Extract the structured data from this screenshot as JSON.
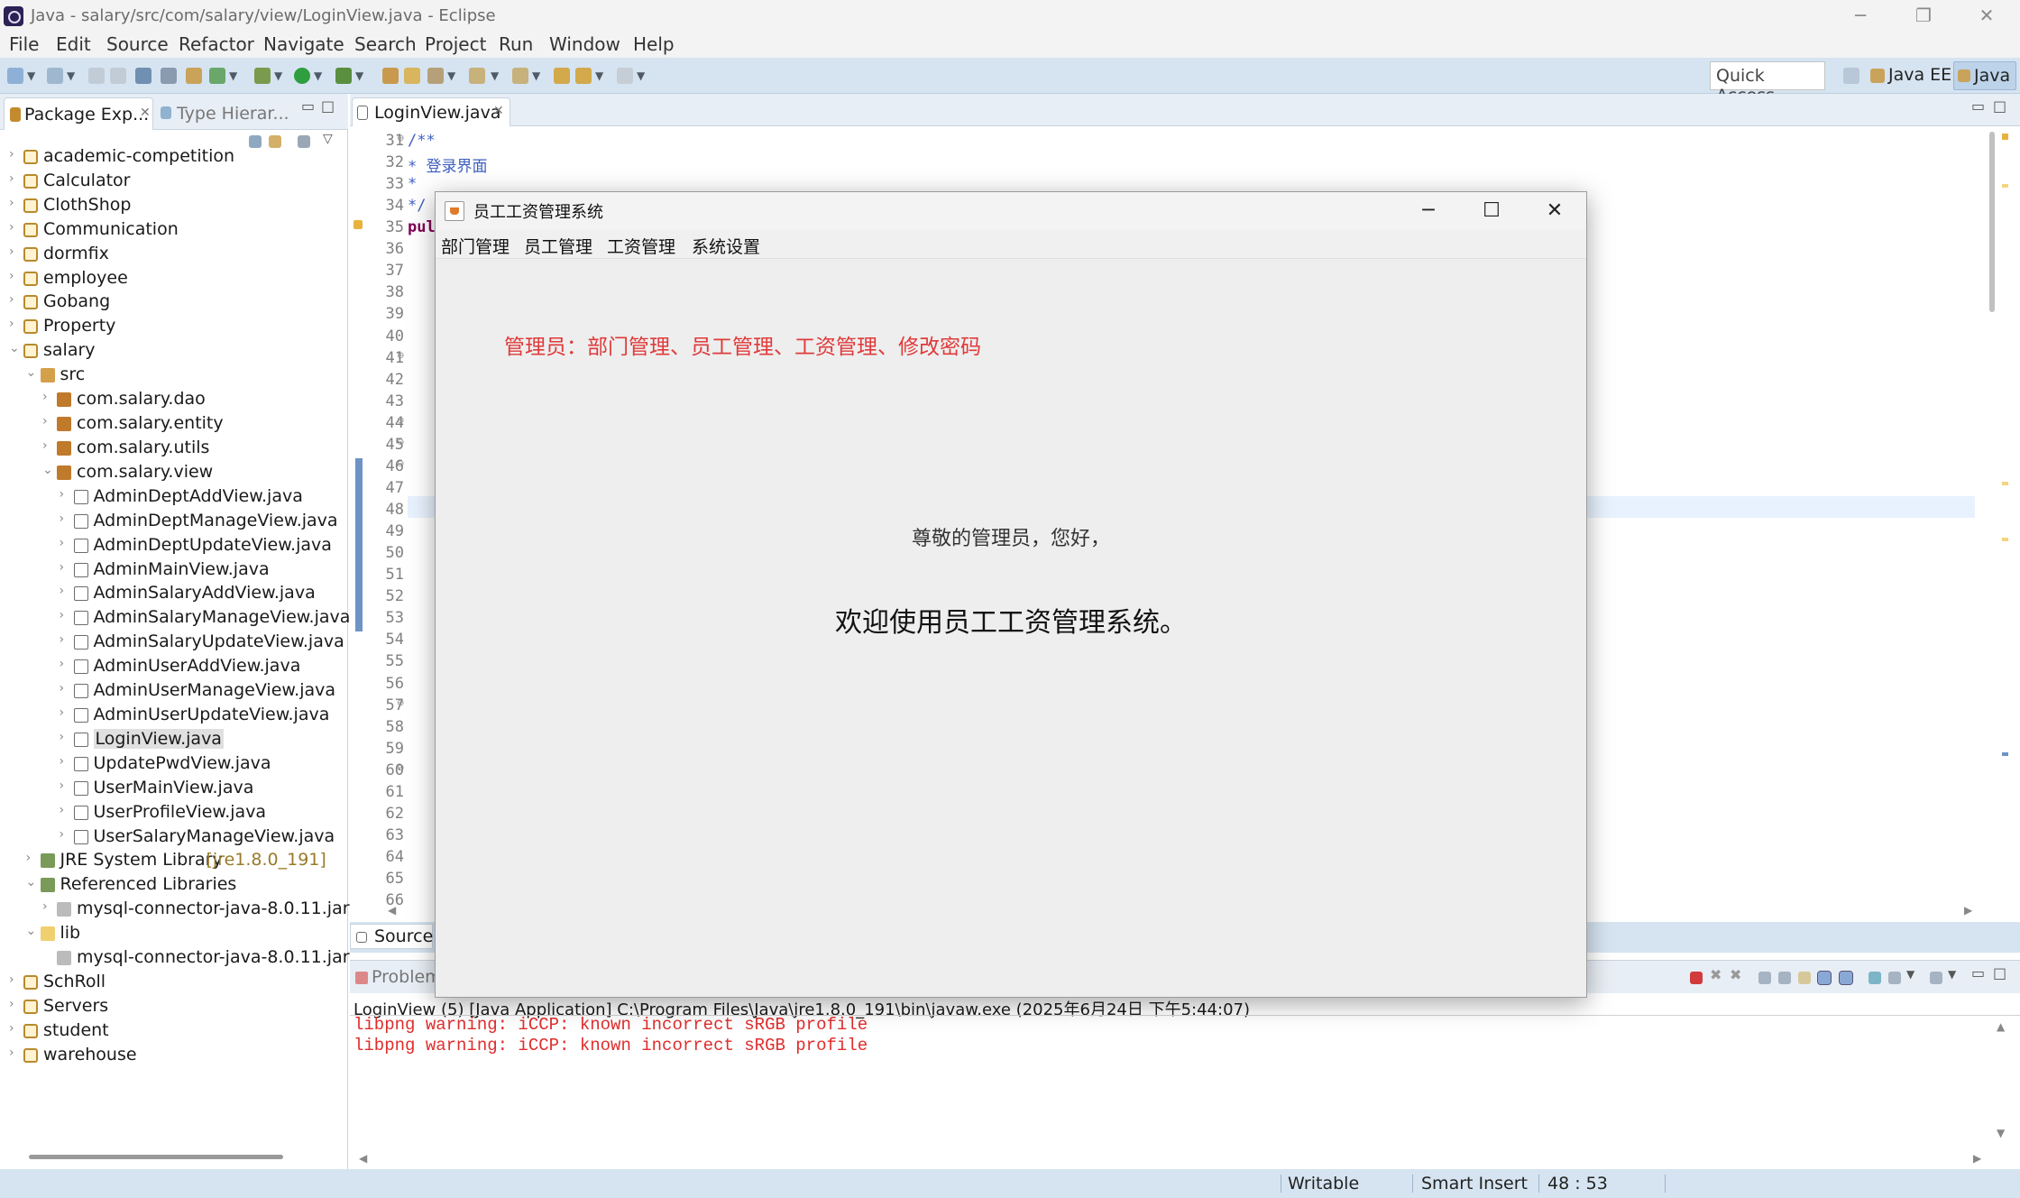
{
  "window": {
    "title": "Java - salary/src/com/salary/view/LoginView.java - Eclipse",
    "minimize": "─",
    "restore": "❐",
    "close": "✕"
  },
  "menu": [
    "File",
    "Edit",
    "Source",
    "Refactor",
    "Navigate",
    "Search",
    "Project",
    "Run",
    "Window",
    "Help"
  ],
  "toolbar": {
    "quick_access": "Quick Access",
    "perspectives": [
      "Java EE",
      "Java"
    ]
  },
  "left_panel": {
    "tabs": [
      "Package Exp...",
      "Type Hierar..."
    ],
    "tree": [
      {
        "label": "academic-competition",
        "level": 0,
        "icon": "project-icon",
        "expanded": false
      },
      {
        "label": "Calculator",
        "level": 0,
        "icon": "project-icon",
        "expanded": false
      },
      {
        "label": "ClothShop",
        "level": 0,
        "icon": "project-icon",
        "expanded": false
      },
      {
        "label": "Communication",
        "level": 0,
        "icon": "project-icon",
        "expanded": false
      },
      {
        "label": "dormfix",
        "level": 0,
        "icon": "project-icon",
        "expanded": false
      },
      {
        "label": "employee",
        "level": 0,
        "icon": "project-icon",
        "expanded": false
      },
      {
        "label": "Gobang",
        "level": 0,
        "icon": "project-icon",
        "expanded": false
      },
      {
        "label": "Property",
        "level": 0,
        "icon": "project-icon",
        "expanded": false
      },
      {
        "label": "salary",
        "level": 0,
        "icon": "project-icon",
        "expanded": true
      },
      {
        "label": "src",
        "level": 1,
        "icon": "source-folder-icon",
        "expanded": true
      },
      {
        "label": "com.salary.dao",
        "level": 2,
        "icon": "package-icon",
        "expanded": false
      },
      {
        "label": "com.salary.entity",
        "level": 2,
        "icon": "package-icon",
        "expanded": false
      },
      {
        "label": "com.salary.utils",
        "level": 2,
        "icon": "package-icon",
        "expanded": false
      },
      {
        "label": "com.salary.view",
        "level": 2,
        "icon": "package-icon",
        "expanded": true
      },
      {
        "label": "AdminDeptAddView.java",
        "level": 3,
        "icon": "java-file-icon",
        "expanded": false
      },
      {
        "label": "AdminDeptManageView.java",
        "level": 3,
        "icon": "java-file-icon",
        "expanded": false
      },
      {
        "label": "AdminDeptUpdateView.java",
        "level": 3,
        "icon": "java-file-icon",
        "expanded": false
      },
      {
        "label": "AdminMainView.java",
        "level": 3,
        "icon": "java-file-icon",
        "expanded": false
      },
      {
        "label": "AdminSalaryAddView.java",
        "level": 3,
        "icon": "java-file-icon",
        "expanded": false
      },
      {
        "label": "AdminSalaryManageView.java",
        "level": 3,
        "icon": "java-file-icon",
        "expanded": false
      },
      {
        "label": "AdminSalaryUpdateView.java",
        "level": 3,
        "icon": "java-file-icon",
        "expanded": false
      },
      {
        "label": "AdminUserAddView.java",
        "level": 3,
        "icon": "java-file-icon",
        "expanded": false
      },
      {
        "label": "AdminUserManageView.java",
        "level": 3,
        "icon": "java-file-icon",
        "expanded": false
      },
      {
        "label": "AdminUserUpdateView.java",
        "level": 3,
        "icon": "java-file-icon",
        "expanded": false
      },
      {
        "label": "LoginView.java",
        "level": 3,
        "icon": "java-file-icon",
        "expanded": false,
        "selected": true
      },
      {
        "label": "UpdatePwdView.java",
        "level": 3,
        "icon": "java-file-icon",
        "expanded": false
      },
      {
        "label": "UserMainView.java",
        "level": 3,
        "icon": "java-file-icon",
        "expanded": false
      },
      {
        "label": "UserProfileView.java",
        "level": 3,
        "icon": "java-file-icon",
        "expanded": false
      },
      {
        "label": "UserSalaryManageView.java",
        "level": 3,
        "icon": "java-file-icon",
        "expanded": false
      },
      {
        "label": "JRE System Library",
        "suffix": "[jre1.8.0_191]",
        "level": 1,
        "icon": "library-icon",
        "expanded": false
      },
      {
        "label": "Referenced Libraries",
        "level": 1,
        "icon": "library-icon",
        "expanded": true
      },
      {
        "label": "mysql-connector-java-8.0.11.jar",
        "level": 2,
        "icon": "jar-icon",
        "expanded": false
      },
      {
        "label": "lib",
        "level": 1,
        "icon": "folder-icon",
        "expanded": true
      },
      {
        "label": "mysql-connector-java-8.0.11.jar",
        "level": 2,
        "icon": "jar-icon",
        "leaf": true
      },
      {
        "label": "SchRoll",
        "level": 0,
        "icon": "project-icon",
        "expanded": false
      },
      {
        "label": "Servers",
        "level": 0,
        "icon": "project-icon",
        "expanded": false
      },
      {
        "label": "student",
        "level": 0,
        "icon": "project-icon",
        "expanded": false
      },
      {
        "label": "warehouse",
        "level": 0,
        "icon": "project-icon",
        "expanded": false
      }
    ]
  },
  "editor": {
    "tab": "LoginView.java",
    "line_numbers": [
      "31",
      "32",
      "33",
      "34",
      "35",
      "36",
      "37",
      "38",
      "39",
      "40",
      "41",
      "42",
      "43",
      "44",
      "45",
      "46",
      "47",
      "48",
      "49",
      "50",
      "51",
      "52",
      "53",
      "54",
      "55",
      "56",
      "57",
      "58",
      "59",
      "60",
      "61",
      "62",
      "63",
      "64",
      "65",
      "66"
    ],
    "code": {
      "31": "/**",
      "32": " * 登录界面",
      "33": " *",
      "34": " */",
      "35": "pul"
    },
    "source_tab": "Source"
  },
  "console": {
    "tab": "Problem",
    "title": "LoginView (5) [Java Application] C:\\Program Files\\Java\\jre1.8.0_191\\bin\\javaw.exe (2025年6月24日 下午5:44:07)",
    "lines": [
      "libpng warning: iCCP: known incorrect sRGB profile",
      "libpng warning: iCCP: known incorrect sRGB profile"
    ]
  },
  "status": {
    "writable": "Writable",
    "insert_mode": "Smart Insert",
    "position": "48 : 53"
  },
  "dialog": {
    "title": "员工工资管理系统",
    "menu": [
      "部门管理",
      "员工管理",
      "工资管理",
      "系统设置"
    ],
    "admin_desc": "管理员：部门管理、员工管理、工资管理、修改密码",
    "greeting": "尊敬的管理员，您好，",
    "welcome": "欢迎使用员工工资管理系统。"
  },
  "colors": {
    "accent_red": "#e03a3a",
    "toolbar_bg": "#d6e4f1"
  }
}
